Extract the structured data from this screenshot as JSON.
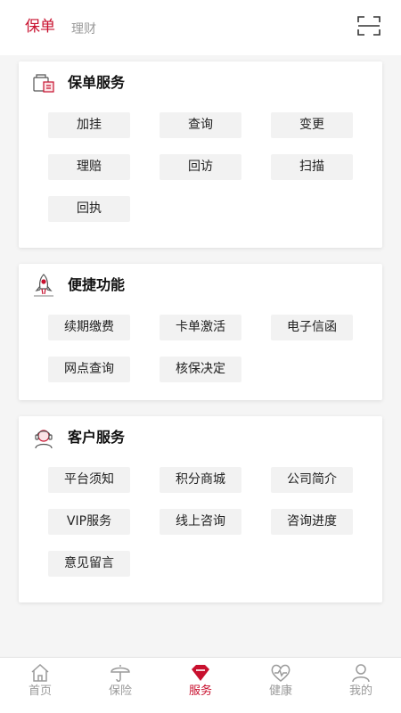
{
  "header": {
    "tabs": [
      {
        "label": "保单",
        "active": true
      },
      {
        "label": "理财",
        "active": false
      }
    ],
    "scan_icon": "scan-icon"
  },
  "sections": [
    {
      "title": "保单服务",
      "icon": "policy-document-icon",
      "buttons": [
        "加挂",
        "查询",
        "变更",
        "理赔",
        "回访",
        "扫描",
        "回执"
      ]
    },
    {
      "title": "便捷功能",
      "icon": "rocket-icon",
      "buttons": [
        "续期缴费",
        "卡单激活",
        "电子信函",
        "网点查询",
        "核保决定"
      ]
    },
    {
      "title": "客户服务",
      "icon": "customer-service-agent-icon",
      "buttons": [
        "平台须知",
        "积分商城",
        "公司简介",
        "VIP服务",
        "线上咨询",
        "咨询进度",
        "意见留言"
      ]
    }
  ],
  "tab_bar": {
    "items": [
      {
        "label": "首页",
        "icon": "home-icon",
        "active": false
      },
      {
        "label": "保险",
        "icon": "umbrella-icon",
        "active": false
      },
      {
        "label": "服务",
        "icon": "service-gem-icon",
        "active": true
      },
      {
        "label": "健康",
        "icon": "heart-pulse-icon",
        "active": false
      },
      {
        "label": "我的",
        "icon": "person-icon",
        "active": false
      }
    ]
  },
  "colors": {
    "accent": "#c8102e",
    "inactive_text": "#9a9a9a",
    "button_bg": "#f2f2f2",
    "page_bg": "#f5f5f5"
  }
}
